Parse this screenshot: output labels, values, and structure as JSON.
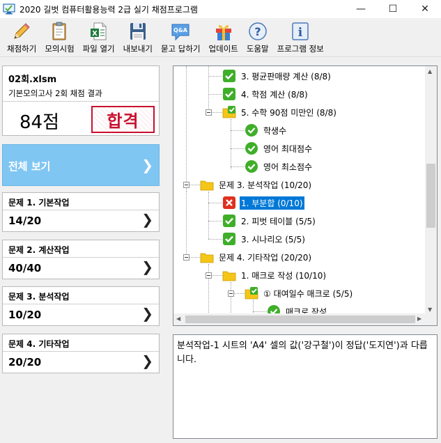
{
  "window": {
    "title": "2020 길벗 컴퓨터활용능력 2급 실기 채점프로그램",
    "minimize": "—",
    "maximize": "☐",
    "close": "✕"
  },
  "toolbar": {
    "items": [
      {
        "label": "채점하기",
        "icon": "pencil-icon"
      },
      {
        "label": "모의시험",
        "icon": "clipboard-icon"
      },
      {
        "label": "파일 열기",
        "icon": "excel-file-icon"
      },
      {
        "label": "내보내기",
        "icon": "floppy-disk-icon"
      },
      {
        "label": "묻고 답하기",
        "icon": "qa-bubble-icon"
      },
      {
        "label": "업데이트",
        "icon": "gift-icon"
      },
      {
        "label": "도움말",
        "icon": "help-icon"
      },
      {
        "label": "프로그램 정보",
        "icon": "info-icon"
      }
    ]
  },
  "summary": {
    "file_name": "02회.xlsm",
    "subtitle": "기본모의고사 2회 채점 결과",
    "score": "84점",
    "stamp": "합격",
    "stamp_color": "#c8102e"
  },
  "all_view": {
    "label": "전체 보기",
    "accent": "#80c6f3"
  },
  "sections": [
    {
      "title": "문제 1. 기본작업",
      "score": "14/20"
    },
    {
      "title": "문제 2. 계산작업",
      "score": "40/40"
    },
    {
      "title": "문제 3. 분석작업",
      "score": "10/20"
    },
    {
      "title": "문제 4. 기타작업",
      "score": "20/20"
    }
  ],
  "tree": {
    "nodes": [
      {
        "label": "3. 평균판매량 계산 (8/8)",
        "status": "pass"
      },
      {
        "label": "4. 학점 계산 (8/8)",
        "status": "pass"
      },
      {
        "label": "5. 수학 90점 미만인 (8/8)",
        "status": "pass-folder"
      },
      {
        "label": "학생수",
        "status": "pass-round"
      },
      {
        "label": "영어 최대점수",
        "status": "pass-round"
      },
      {
        "label": "영어 최소점수",
        "status": "pass-round"
      },
      {
        "label": "문제 3. 분석작업 (10/20)",
        "status": "folder"
      },
      {
        "label": "1. 부분합 (0/10)",
        "status": "fail",
        "selected": true
      },
      {
        "label": "2. 피벗 테이블 (5/5)",
        "status": "pass"
      },
      {
        "label": "3. 시나리오 (5/5)",
        "status": "pass"
      },
      {
        "label": "문제 4. 기타작업 (20/20)",
        "status": "folder"
      },
      {
        "label": "1. 매크로 작성 (10/10)",
        "status": "folder"
      },
      {
        "label": "① 대여일수 매크로 (5/5)",
        "status": "pass-folder"
      },
      {
        "label": "매크로 작성",
        "status": "pass-round"
      }
    ]
  },
  "message": {
    "text": "분석작업-1 시트의 'A4' 셀의 값('강구철')이 정답('도지연')과 다릅니다."
  },
  "colors": {
    "pass": "#3fae29",
    "fail": "#e0301e",
    "folder": "#f5c518",
    "selection": "#0078d7"
  }
}
